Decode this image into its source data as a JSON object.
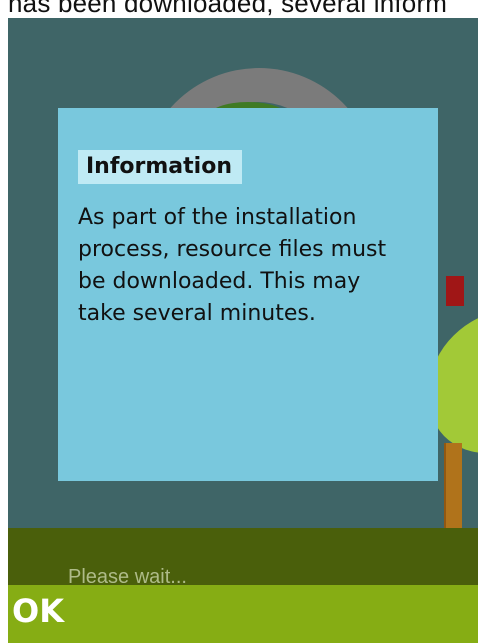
{
  "top_caption": "has been downloaded, several inform",
  "dialog": {
    "title": "Information",
    "message": "As part of the installation process, resource files must be downloaded. This may take several minutes."
  },
  "status": {
    "text": "Please wait..."
  },
  "softkeys": {
    "left_label": "OK"
  },
  "colors": {
    "background": "#3f6567",
    "dialog": "#79c8dd",
    "dialog_title": "#bfeaf4",
    "bottom_band": "#4a5f0b",
    "softkey_bar": "#86ad14"
  }
}
